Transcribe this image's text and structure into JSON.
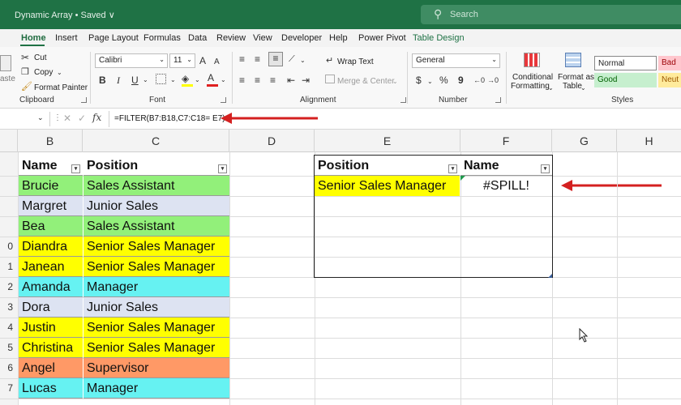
{
  "window": {
    "title": "Dynamic Array • Saved ∨"
  },
  "search": {
    "placeholder": "Search"
  },
  "tabs": [
    "Home",
    "Insert",
    "Page Layout",
    "Formulas",
    "Data",
    "Review",
    "View",
    "Developer",
    "Help",
    "Power Pivot",
    "Table Design"
  ],
  "ribbon": {
    "clipboard": {
      "paste": "aste",
      "cut": "Cut",
      "copy": "Copy",
      "format_painter": "Format Painter",
      "label": "Clipboard"
    },
    "font": {
      "name": "Calibri",
      "size": "11",
      "grow": "A",
      "shrink": "A",
      "bold": "B",
      "italic": "I",
      "underline": "U",
      "label": "Font"
    },
    "alignment": {
      "wrap": "Wrap Text",
      "merge": "Merge & Center",
      "label": "Alignment"
    },
    "number": {
      "format": "General",
      "currency": "$",
      "percent": "%",
      "comma": "9",
      "label": "Number"
    },
    "styles": {
      "conditional": [
        "Conditional",
        "Formatting"
      ],
      "format_table": [
        "Format as",
        "Table"
      ],
      "normal": "Normal",
      "bad": "Bad",
      "good": "Good",
      "neutral": "Neut",
      "label": "Styles"
    }
  },
  "formula_bar": {
    "fx": "fx",
    "formula": "=FILTER(B7:B18,C7:C18= E7)"
  },
  "columns": [
    "B",
    "C",
    "D",
    "E",
    "F",
    "G",
    "H"
  ],
  "row_numbers": [
    "",
    "",
    "",
    "0",
    "1",
    "2",
    "3",
    "4",
    "5",
    "6",
    "7"
  ],
  "table1": {
    "headers": [
      "Name",
      "Position"
    ],
    "rows": [
      {
        "name": "Brucie",
        "position": "Sales Assistant",
        "color": "#92f07a"
      },
      {
        "name": "Margret",
        "position": "Junior Sales",
        "color": "#dde3f2"
      },
      {
        "name": "Bea",
        "position": "Sales Assistant",
        "color": "#92f07a"
      },
      {
        "name": "Diandra",
        "position": "Senior Sales Manager",
        "color": "#ffff00"
      },
      {
        "name": "Janean",
        "position": "Senior Sales Manager",
        "color": "#ffff00"
      },
      {
        "name": "Amanda",
        "position": "Manager",
        "color": "#66f2f2"
      },
      {
        "name": "Dora",
        "position": "Junior Sales",
        "color": "#dde3f2"
      },
      {
        "name": "Justin",
        "position": "Senior Sales Manager",
        "color": "#ffff00"
      },
      {
        "name": "Christina",
        "position": "Senior Sales Manager",
        "color": "#ffff00"
      },
      {
        "name": "Angel",
        "position": "Supervisor",
        "color": "#ff9966"
      },
      {
        "name": "Lucas",
        "position": "Manager",
        "color": "#66f2f2"
      }
    ]
  },
  "table2": {
    "headers": [
      "Position",
      "Name"
    ],
    "criteria": "Senior Sales Manager",
    "criteria_color": "#ffff00",
    "result": "#SPILL!"
  },
  "colors": {
    "excel_green": "#1f7245",
    "arrow_red": "#d42020"
  }
}
